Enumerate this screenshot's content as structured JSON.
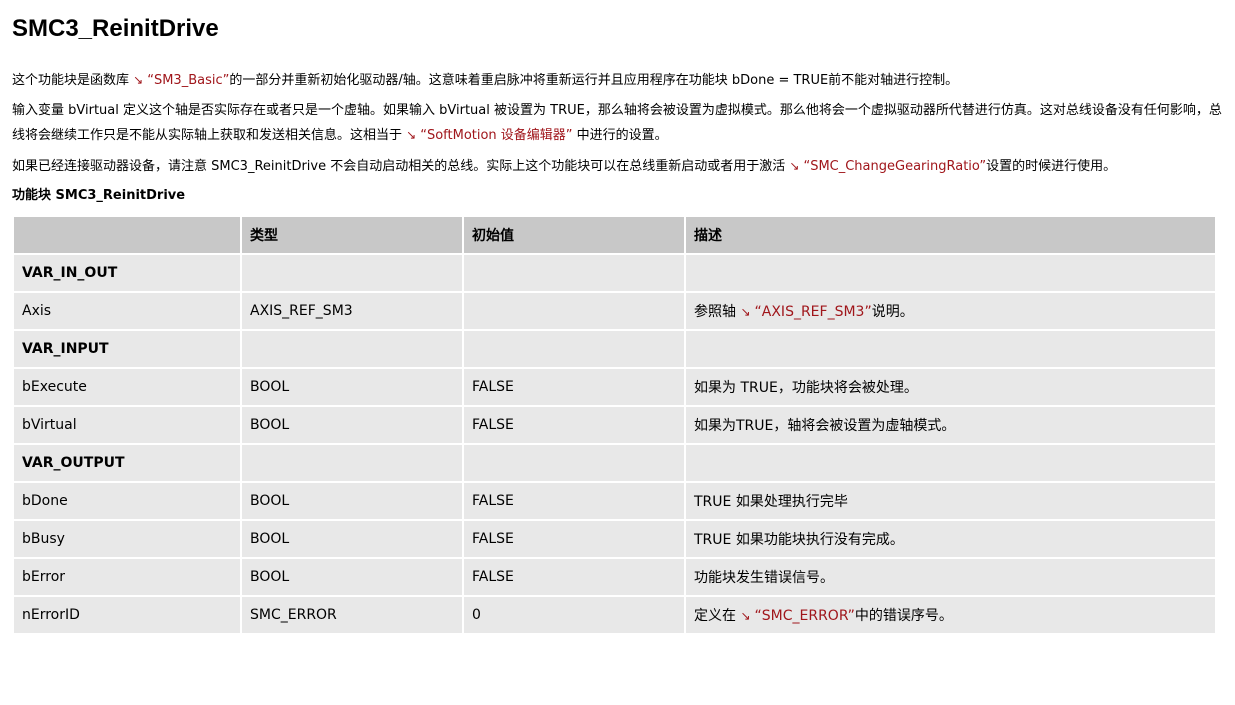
{
  "title": "SMC3_ReinitDrive",
  "para1": {
    "pre": "这个功能块是函数库",
    "link": "“SM3_Basic”",
    "post": "的一部分并重新初始化驱动器/轴。这意味着重启脉冲将重新运行并且应用程序在功能块 bDone = TRUE前不能对轴进行控制。"
  },
  "para2": {
    "pre": "输入变量 bVirtual 定义这个轴是否实际存在或者只是一个虚轴。如果输入 bVirtual 被设置为 TRUE，那么轴将会被设置为虚拟模式。那么他将会一个虚拟驱动器所代替进行仿真。这对总线设备没有任何影响，总线将会继续工作只是不能从实际轴上获取和发送相关信息。这相当于",
    "link": "“SoftMotion 设备编辑器”",
    "post": " 中进行的设置。"
  },
  "para3": {
    "pre": "如果已经连接驱动器设备，请注意 SMC3_ReinitDrive 不会自动启动相关的总线。实际上这个功能块可以在总线重新启动或者用于激活",
    "link": "“SMC_ChangeGearingRatio”",
    "post": "设置的时候进行使用。"
  },
  "arrow_glyph": "↘",
  "caption": "功能块 SMC3_ReinitDrive",
  "table": {
    "headers": [
      "",
      "类型",
      "初始值",
      "描述"
    ],
    "rows": [
      {
        "group": "VAR_IN_OUT"
      },
      {
        "name": "Axis",
        "type": "AXIS_REF_SM3",
        "init": "",
        "desc_pre": "参照轴",
        "desc_link": "“AXIS_REF_SM3”",
        "desc_post": "说明。"
      },
      {
        "group": "VAR_INPUT"
      },
      {
        "name": "bExecute",
        "type": "BOOL",
        "init": "FALSE",
        "desc_pre": "如果为 TRUE，功能块将会被处理。"
      },
      {
        "name": "bVirtual",
        "type": "BOOL",
        "init": "FALSE",
        "desc_pre": "如果为TRUE，轴将会被设置为虚轴模式。"
      },
      {
        "group": "VAR_OUTPUT"
      },
      {
        "name": "bDone",
        "type": "BOOL",
        "init": "FALSE",
        "desc_pre": "TRUE 如果处理执行完毕"
      },
      {
        "name": "bBusy",
        "type": "BOOL",
        "init": "FALSE",
        "desc_pre": "TRUE 如果功能块执行没有完成。"
      },
      {
        "name": "bError",
        "type": "BOOL",
        "init": "FALSE",
        "desc_pre": "功能块发生错误信号。"
      },
      {
        "name": "nErrorID",
        "type": "SMC_ERROR",
        "init": "0",
        "desc_pre": "定义在",
        "desc_link": "“SMC_ERROR”",
        "desc_post": "中的错误序号。"
      }
    ]
  },
  "colors": {
    "link": "#a0161b",
    "header_bg": "#c8c8c8",
    "cell_bg": "#e8e8e8"
  }
}
